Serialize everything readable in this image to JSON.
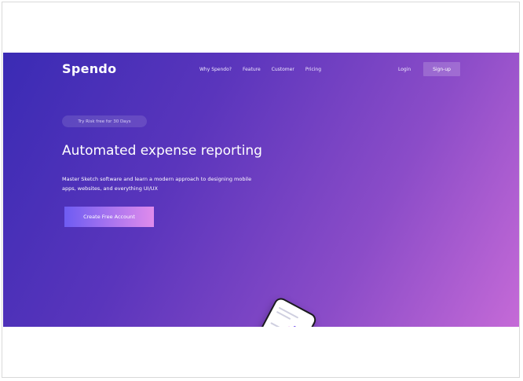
{
  "brand": {
    "name": "Spendo"
  },
  "nav": {
    "items": [
      {
        "label": "Why Spendo?"
      },
      {
        "label": "Feature"
      },
      {
        "label": "Customer"
      },
      {
        "label": "Pricing"
      }
    ],
    "login_label": "Login",
    "signup_label": "Sign-up"
  },
  "hero": {
    "badge": "Try Risk free for 30 Days",
    "headline": "Automated expense reporting",
    "subtext": "Master Sketch software and learn a modern approach to designing mobile apps, websites, and everything UI/UX",
    "cta_label": "Create Free Account"
  },
  "colors": {
    "gradient_start": "#3a2bb4",
    "gradient_end": "#c56ad7",
    "cta_start": "#6e5cf2",
    "cta_end": "#e08bec"
  }
}
